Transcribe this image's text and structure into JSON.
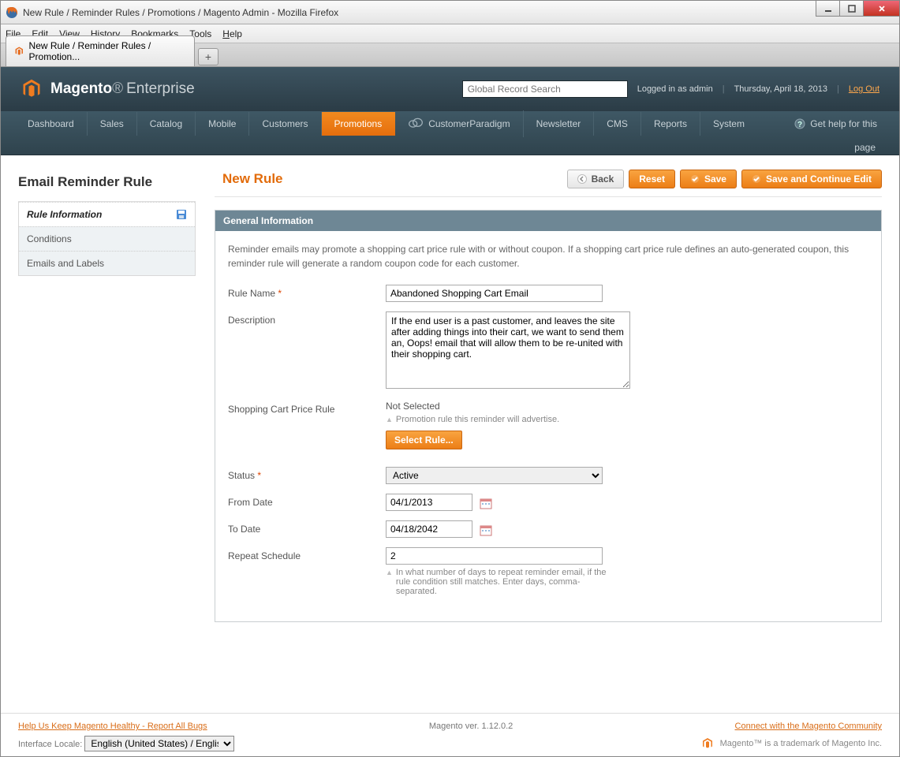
{
  "window": {
    "title": "New Rule / Reminder Rules / Promotions / Magento Admin - Mozilla Firefox"
  },
  "browser_menu": [
    "File",
    "Edit",
    "View",
    "History",
    "Bookmarks",
    "Tools",
    "Help"
  ],
  "tab": {
    "label": "New Rule / Reminder Rules / Promotion..."
  },
  "header": {
    "brand_bold": "Magento",
    "brand_light": "Enterprise",
    "search_placeholder": "Global Record Search",
    "logged_in": "Logged in as admin",
    "date": "Thursday, April 18, 2013",
    "logout": "Log Out"
  },
  "nav": {
    "items": [
      "Dashboard",
      "Sales",
      "Catalog",
      "Mobile",
      "Customers",
      "Promotions",
      "CustomerParadigm",
      "Newsletter",
      "CMS",
      "Reports",
      "System"
    ],
    "active_index": 5,
    "help": "Get help for this",
    "help2": "page"
  },
  "sidebar": {
    "title": "Email Reminder Rule",
    "items": [
      {
        "label": "Rule Information",
        "active": true,
        "icon": true
      },
      {
        "label": "Conditions"
      },
      {
        "label": "Emails and Labels"
      }
    ]
  },
  "page": {
    "title": "New Rule",
    "buttons": {
      "back": "Back",
      "reset": "Reset",
      "save": "Save",
      "save_continue": "Save and Continue Edit"
    }
  },
  "panel": {
    "title": "General Information",
    "desc": "Reminder emails may promote a shopping cart price rule with or without coupon. If a shopping cart price rule defines an auto-generated coupon, this reminder rule will generate a random coupon code for each customer.",
    "fields": {
      "rule_name": {
        "label": "Rule Name",
        "required": true,
        "value": "Abandoned Shopping Cart Email"
      },
      "description": {
        "label": "Description",
        "value": "If the end user is a past customer, and leaves the site after adding things into their cart, we want to send them an, Oops! email that will allow them to be re-united with their shopping cart."
      },
      "price_rule": {
        "label": "Shopping Cart Price Rule",
        "value": "Not Selected",
        "note": "Promotion rule this reminder will advertise.",
        "button": "Select Rule..."
      },
      "status": {
        "label": "Status",
        "required": true,
        "value": "Active"
      },
      "from_date": {
        "label": "From Date",
        "value": "04/1/2013"
      },
      "to_date": {
        "label": "To Date",
        "value": "04/18/2042"
      },
      "repeat": {
        "label": "Repeat Schedule",
        "value": "2",
        "note": "In what number of days to repeat reminder email, if the rule condition still matches. Enter days, comma-separated."
      }
    }
  },
  "footer": {
    "bugs": "Help Us Keep Magento Healthy - Report All Bugs",
    "version": "Magento ver. 1.12.0.2",
    "community": "Connect with the Magento Community",
    "locale_label": "Interface Locale:",
    "locale_value": "English (United States) / English",
    "trademark": "Magento™ is a trademark of Magento Inc."
  }
}
